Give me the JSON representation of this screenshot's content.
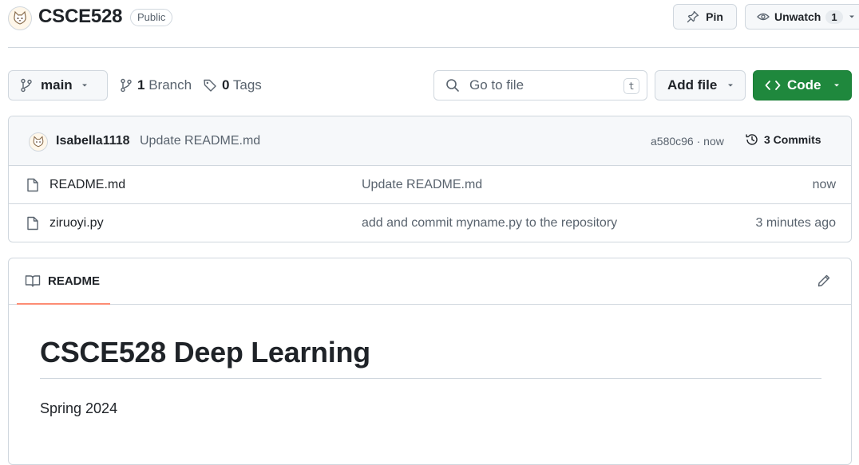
{
  "repo": {
    "name": "CSCE528",
    "visibility": "Public",
    "avatar_icon": "cat-avatar"
  },
  "actions": {
    "pin_label": "Pin",
    "unwatch_label": "Unwatch",
    "watch_count": "1"
  },
  "toolbar": {
    "branch": "main",
    "branch_count": "1",
    "branch_label": "Branch",
    "tag_count": "0",
    "tag_label": "Tags",
    "search_placeholder": "Go to file",
    "search_shortcut": "t",
    "add_file_label": "Add file",
    "code_label": "Code"
  },
  "latest_commit": {
    "author": "Isabella1118",
    "message": "Update README.md",
    "hash_time": "a580c96 · now",
    "commits_label": "3 Commits"
  },
  "files": [
    {
      "name": "README.md",
      "commit": "Update README.md",
      "time": "now",
      "icon": "file-icon"
    },
    {
      "name": "ziruoyi.py",
      "commit": "add and commit myname.py to the repository",
      "time": "3 minutes ago",
      "icon": "file-icon"
    }
  ],
  "readme": {
    "tab_label": "README",
    "heading": "CSCE528 Deep Learning",
    "paragraph": "Spring 2024"
  },
  "colors": {
    "code_button": "#1f883d",
    "tab_underline": "#fd8c73",
    "border": "#d0d7de",
    "muted_text": "#59636e"
  }
}
